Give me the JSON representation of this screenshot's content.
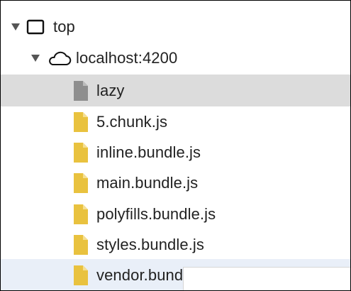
{
  "tree": {
    "root": {
      "label": "top",
      "toggle_icon": "triangle-down-icon",
      "icon": "frame-window-icon"
    },
    "origin": {
      "label": "localhost:4200",
      "toggle_icon": "triangle-down-icon",
      "icon": "cloud-icon"
    },
    "files": [
      {
        "label": "lazy",
        "icon": "file-icon",
        "color": "#8e8e8e",
        "state": "highlighted"
      },
      {
        "label": "5.chunk.js",
        "icon": "file-icon",
        "color": "#e9c23f",
        "state": ""
      },
      {
        "label": "inline.bundle.js",
        "icon": "file-icon",
        "color": "#e9c23f",
        "state": ""
      },
      {
        "label": "main.bundle.js",
        "icon": "file-icon",
        "color": "#e9c23f",
        "state": ""
      },
      {
        "label": "polyfills.bundle.js",
        "icon": "file-icon",
        "color": "#e9c23f",
        "state": ""
      },
      {
        "label": "styles.bundle.js",
        "icon": "file-icon",
        "color": "#e9c23f",
        "state": ""
      },
      {
        "label": "vendor.bundle.js",
        "icon": "file-icon",
        "color": "#e9c23f",
        "state": "selected"
      }
    ]
  },
  "colors": {
    "highlight_row": "#dcdcdc",
    "selected_row": "#e9eff8",
    "text": "#222222"
  }
}
